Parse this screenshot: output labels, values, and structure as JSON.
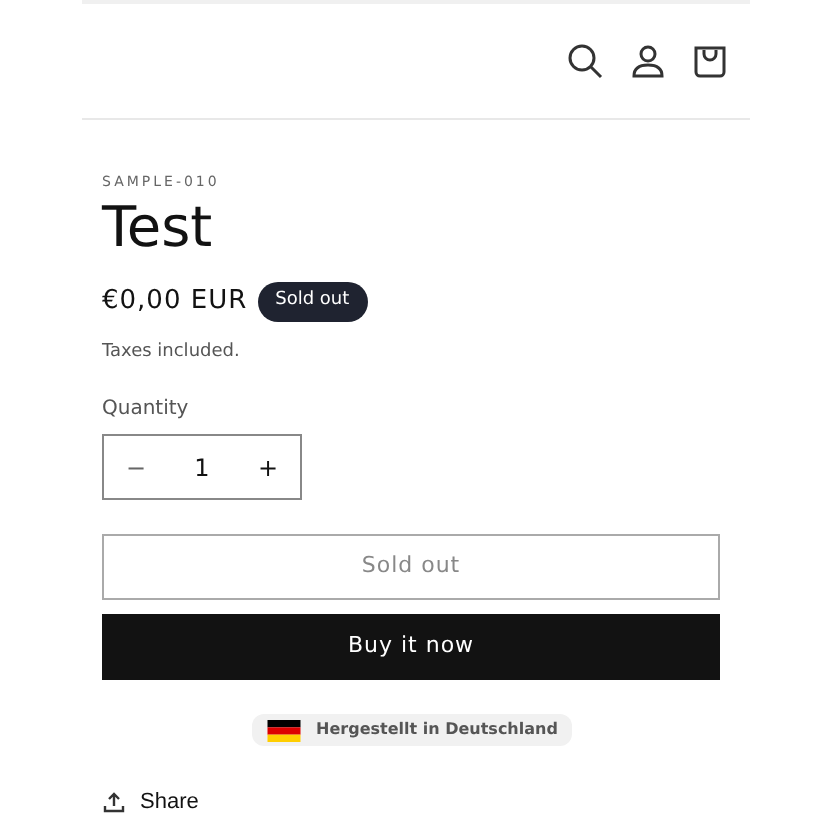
{
  "product": {
    "sku": "SAMPLE-010",
    "title": "Test",
    "price": "€0,00 EUR",
    "badge": "Sold out",
    "tax_note": "Taxes included."
  },
  "quantity": {
    "label": "Quantity",
    "decrease": "−",
    "value": "1",
    "increase": "+"
  },
  "buttons": [
    {
      "label": "Sold out",
      "kind": "outline",
      "disabled": true
    },
    {
      "label": "Buy it now",
      "kind": "solid",
      "disabled": false
    }
  ],
  "origin_badge": {
    "label": "Hergestellt in Deutschland"
  },
  "share": {
    "label": "Share"
  }
}
